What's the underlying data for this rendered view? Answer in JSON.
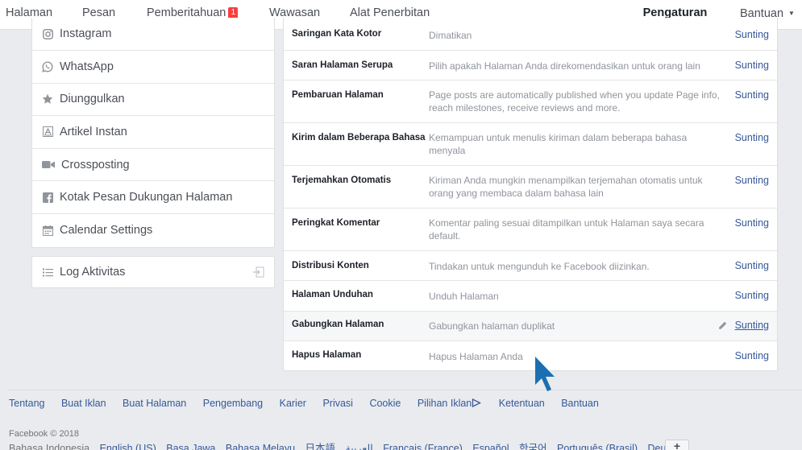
{
  "topnav": {
    "items": [
      {
        "label": "Halaman"
      },
      {
        "label": "Pesan"
      },
      {
        "label": "Pemberitahuan",
        "badge": "1"
      },
      {
        "label": "Wawasan"
      },
      {
        "label": "Alat Penerbitan"
      },
      {
        "label": "Pengaturan",
        "active": true
      },
      {
        "label": "Bantuan"
      }
    ],
    "help_caret": "▼"
  },
  "sidebar": {
    "items": [
      {
        "label": "Instagram",
        "icon": "instagram-icon"
      },
      {
        "label": "WhatsApp",
        "icon": "whatsapp-icon"
      },
      {
        "label": "Diunggulkan",
        "icon": "star-icon"
      },
      {
        "label": "Artikel Instan",
        "icon": "instant-article-icon"
      },
      {
        "label": "Crossposting",
        "icon": "video-camera-icon"
      },
      {
        "label": "Kotak Pesan Dukungan Halaman",
        "icon": "facebook-icon"
      },
      {
        "label": "Calendar Settings",
        "icon": "calendar-icon"
      }
    ],
    "log": {
      "label": "Log Aktivitas",
      "icon": "list-icon"
    }
  },
  "settings": {
    "rows": [
      {
        "label": "Saringan Kata Kotor",
        "desc": "Dimatikan",
        "edit": "Sunting"
      },
      {
        "label": "Saran Halaman Serupa",
        "desc": "Pilih apakah Halaman Anda direkomendasikan untuk orang lain",
        "edit": "Sunting"
      },
      {
        "label": "Pembaruan Halaman",
        "desc": "Page posts are automatically published when you update Page info, reach milestones, receive reviews and more.",
        "edit": "Sunting"
      },
      {
        "label": "Kirim dalam Beberapa Bahasa",
        "desc": "Kemampuan untuk menulis kiriman dalam beberapa bahasa menyala",
        "edit": "Sunting"
      },
      {
        "label": "Terjemahkan Otomatis",
        "desc": "Kiriman Anda mungkin menampilkan terjemahan otomatis untuk orang yang membaca dalam bahasa lain",
        "edit": "Sunting"
      },
      {
        "label": "Peringkat Komentar",
        "desc": "Komentar paling sesuai ditampilkan untuk Halaman saya secara default.",
        "edit": "Sunting"
      },
      {
        "label": "Distribusi Konten",
        "desc": "Tindakan untuk mengunduh ke Facebook diizinkan.",
        "edit": "Sunting"
      },
      {
        "label": "Halaman Unduhan",
        "desc": "Unduh Halaman",
        "edit": "Sunting"
      },
      {
        "label": "Gabungkan Halaman",
        "desc": "Gabungkan halaman duplikat",
        "edit": "Sunting",
        "hover": true
      },
      {
        "label": "Hapus Halaman",
        "desc": "Hapus Halaman Anda",
        "edit": "Sunting"
      }
    ]
  },
  "footer": {
    "links": [
      "Tentang",
      "Buat Iklan",
      "Buat Halaman",
      "Pengembang",
      "Karier",
      "Privasi",
      "Cookie",
      "Pilihan Iklan",
      "Ketentuan",
      "Bantuan"
    ],
    "copyright": "Facebook © 2018",
    "languages": [
      "Bahasa Indonesia",
      "English (US)",
      "Basa Jawa",
      "Bahasa Melayu",
      "日本語",
      "العربية",
      "Français (France)",
      "Español",
      "한국어",
      "Português (Brasil)",
      "Deutsch"
    ],
    "lang_add": "+"
  },
  "colors": {
    "accent": "#4267b2",
    "link": "#365899",
    "badge": "#fa3e3e",
    "cursor": "#1a6fb3"
  }
}
